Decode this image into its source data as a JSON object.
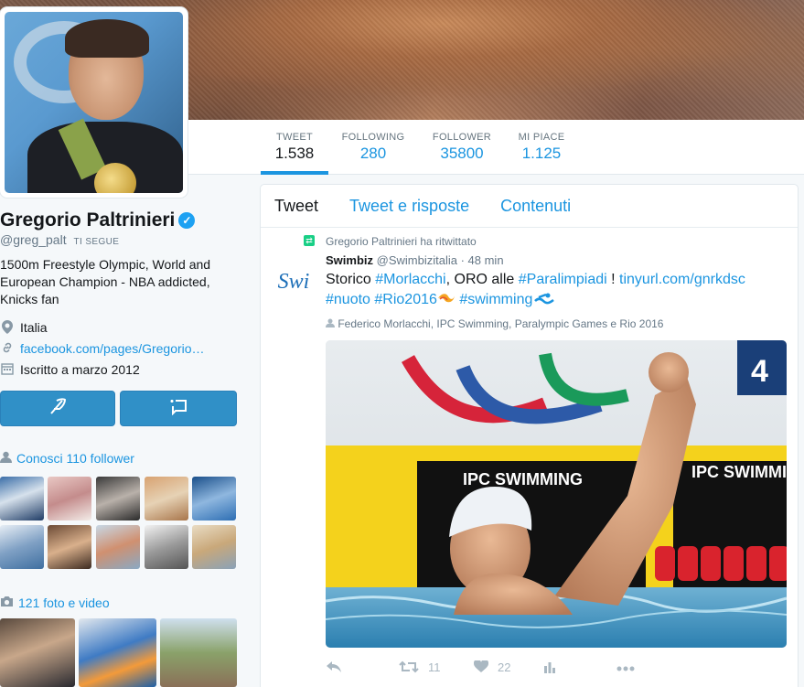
{
  "profile": {
    "name": "Gregorio Paltrinieri",
    "handle": "@greg_palt",
    "follows_you": "TI SEGUE",
    "bio": "1500m Freestyle Olympic, World and European Champion - NBA addicted, Knicks fan",
    "location": "Italia",
    "website": "facebook.com/pages/Gregorio…",
    "joined": "Iscritto a marzo 2012",
    "verified_color": "#1da1f2"
  },
  "nav": {
    "tweet_label": "TWEET",
    "tweet_value": "1.538",
    "following_label": "FOLLOWING",
    "following_value": "280",
    "follower_label": "FOLLOWER",
    "follower_value": "35800",
    "likes_label": "MI PIACE",
    "likes_value": "1.125"
  },
  "sidebar": {
    "followers_title": "Conosci 110 follower",
    "media_title": "121 foto e video"
  },
  "timeline": {
    "tabs": [
      "Tweet",
      "Tweet e risposte",
      "Contenuti"
    ],
    "retweet_note": "Gregorio Paltrinieri ha ritwittato",
    "tweet": {
      "author": "Swimbiz",
      "handle": "@Swimbizitalia",
      "time": "· 48 min",
      "avatar_text": "Swi",
      "text_1": "Storico ",
      "hashtag_1": "#Morlacchi",
      "text_2": ", ORO alle ",
      "hashtag_2": "#Paralimpiadi",
      "text_3": " ! ",
      "link": "tinyurl.com/gnrkdsc",
      "hashtag_3": "#nuoto",
      "hashtag_4": "#Rio2016",
      "hashtag_5": "#swimming",
      "tagged": "Federico Morlacchi, IPC Swimming, Paralympic Games e Rio 2016",
      "photo_banner_1": "IPC SWIMMING",
      "photo_banner_2": "IPC SWIMMING",
      "photo_lane": "4",
      "retweets": "11",
      "likes": "22"
    }
  },
  "colors": {
    "accent": "#1b95e0",
    "button": "#3090c7",
    "retweet_green": "#19cf86"
  }
}
